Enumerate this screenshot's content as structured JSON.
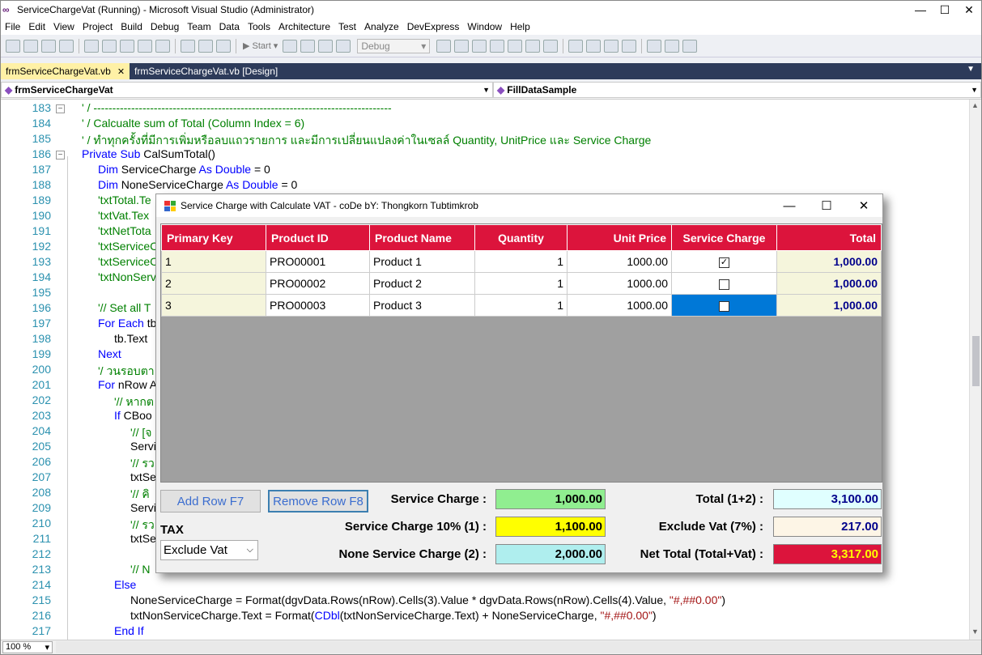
{
  "window": {
    "title": "ServiceChargeVat (Running) - Microsoft Visual Studio (Administrator)",
    "min": "—",
    "max": "☐",
    "close": "✕"
  },
  "menu": [
    "File",
    "Edit",
    "View",
    "Project",
    "Build",
    "Debug",
    "Team",
    "Data",
    "Tools",
    "Architecture",
    "Test",
    "Analyze",
    "DevExpress",
    "Window",
    "Help"
  ],
  "toolbar": {
    "start_label": "▶ Start ▾",
    "config": "Debug"
  },
  "tabs": [
    {
      "label": "frmServiceChargeVat.vb",
      "close": "✕"
    },
    {
      "label": "frmServiceChargeVat.vb [Design]"
    }
  ],
  "nav": {
    "left": "frmServiceChargeVat",
    "right": "FillDataSample"
  },
  "code_lines": [
    {
      "n": "183",
      "t": "' / -------------------------------------------------------------------------------",
      "c": "cm",
      "i": 0
    },
    {
      "n": "184",
      "t": "' / Calcualte sum of Total (Column Index = 6)",
      "c": "cm",
      "i": 0
    },
    {
      "n": "185",
      "t": "' / ทำทุกครั้งที่มีการเพิ่มหรือลบแถวรายการ และมีการเปลี่ยนแปลงค่าในเซลล์ Quantity, UnitPrice และ Service Charge",
      "c": "cm",
      "i": 0
    },
    {
      "n": "186",
      "t": "Private Sub CalSumTotal()",
      "c": "",
      "i": 0
    },
    {
      "n": "187",
      "t": "Dim ServiceCharge As Double = 0",
      "c": "",
      "i": 1
    },
    {
      "n": "188",
      "t": "Dim NoneServiceCharge As Double = 0",
      "c": "",
      "i": 1
    },
    {
      "n": "189",
      "t": "'txtTotal.Te",
      "c": "cm",
      "i": 1
    },
    {
      "n": "190",
      "t": "'txtVat.Tex",
      "c": "cm",
      "i": 1
    },
    {
      "n": "191",
      "t": "'txtNetTota",
      "c": "cm",
      "i": 1
    },
    {
      "n": "192",
      "t": "'txtServiceC",
      "c": "cm",
      "i": 1
    },
    {
      "n": "193",
      "t": "'txtServiceC",
      "c": "cm",
      "i": 1
    },
    {
      "n": "194",
      "t": "'txtNonServ",
      "c": "cm",
      "i": 1
    },
    {
      "n": "195",
      "t": "",
      "c": "",
      "i": 1
    },
    {
      "n": "196",
      "t": "'// Set all T",
      "c": "cm",
      "i": 1
    },
    {
      "n": "197",
      "t": "For Each tb",
      "c": "",
      "i": 1
    },
    {
      "n": "198",
      "t": "tb.Text",
      "c": "",
      "i": 2
    },
    {
      "n": "199",
      "t": "Next",
      "c": "kw",
      "i": 1
    },
    {
      "n": "200",
      "t": "'/ วนรอบตา",
      "c": "cm",
      "i": 1
    },
    {
      "n": "201",
      "t": "For nRow A",
      "c": "",
      "i": 1
    },
    {
      "n": "202",
      "t": "'// หากต",
      "c": "cm",
      "i": 2
    },
    {
      "n": "203",
      "t": "If CBoo",
      "c": "",
      "i": 2
    },
    {
      "n": "204",
      "t": "'// [จ",
      "c": "cm",
      "i": 3
    },
    {
      "n": "205",
      "t": "Servi",
      "c": "",
      "i": 3
    },
    {
      "n": "206",
      "t": "'// รว",
      "c": "cm",
      "i": 3
    },
    {
      "n": "207",
      "t": "txtSe",
      "c": "",
      "i": 3
    },
    {
      "n": "208",
      "t": "'// คิ",
      "c": "cm",
      "i": 3
    },
    {
      "n": "209",
      "t": "Servi",
      "c": "",
      "i": 3
    },
    {
      "n": "210",
      "t": "'// รว",
      "c": "cm",
      "i": 3
    },
    {
      "n": "211",
      "t": "txtSe",
      "c": "",
      "i": 3
    },
    {
      "n": "212",
      "t": "",
      "c": "",
      "i": 3
    },
    {
      "n": "213",
      "t": "'// N",
      "c": "cm",
      "i": 3
    },
    {
      "n": "214",
      "t": "Else",
      "c": "kw",
      "i": 2
    },
    {
      "n": "215",
      "t": "NoneServiceCharge = Format(dgvData.Rows(nRow).Cells(3).Value * dgvData.Rows(nRow).Cells(4).Value, \"#,##0.00\")",
      "c": "",
      "i": 3
    },
    {
      "n": "216",
      "t": "txtNonServiceCharge.Text = Format(CDbl(txtNonServiceCharge.Text) + NoneServiceCharge, \"#,##0.00\")",
      "c": "",
      "i": 3
    },
    {
      "n": "217",
      "t": "End If",
      "c": "kw",
      "i": 2
    }
  ],
  "dialog": {
    "title": "Service Charge with Calculate VAT - coDe bY: Thongkorn Tubtimkrob",
    "columns": [
      "Primary Key",
      "Product ID",
      "Product Name",
      "Quantity",
      "Unit Price",
      "Service Charge",
      "Total"
    ],
    "rows": [
      {
        "pk": "1",
        "id": "PRO00001",
        "name": "Product 1",
        "qty": "1",
        "price": "1000.00",
        "sc": true,
        "total": "1,000.00"
      },
      {
        "pk": "2",
        "id": "PRO00002",
        "name": "Product 2",
        "qty": "1",
        "price": "1000.00",
        "sc": false,
        "total": "1,000.00"
      },
      {
        "pk": "3",
        "id": "PRO00003",
        "name": "Product 3",
        "qty": "1",
        "price": "1000.00",
        "sc": false,
        "total": "1,000.00"
      }
    ],
    "add_row": "Add Row F7",
    "remove_row": "Remove Row F8",
    "tax_label": "TAX",
    "tax_value": "Exclude Vat",
    "service_charge_label": "Service Charge :",
    "service_charge": "1,000.00",
    "sc10_label": "Service Charge 10% (1) :",
    "sc10": "1,100.00",
    "none_sc_label": "None Service Charge (2) :",
    "none_sc": "2,000.00",
    "total_label": "Total (1+2) :",
    "total": "3,100.00",
    "vat_label": "Exclude Vat (7%) :",
    "vat": "217.00",
    "net_label": "Net Total (Total+Vat) :",
    "net": "3,317.00"
  },
  "status": {
    "zoom": "100 %"
  }
}
